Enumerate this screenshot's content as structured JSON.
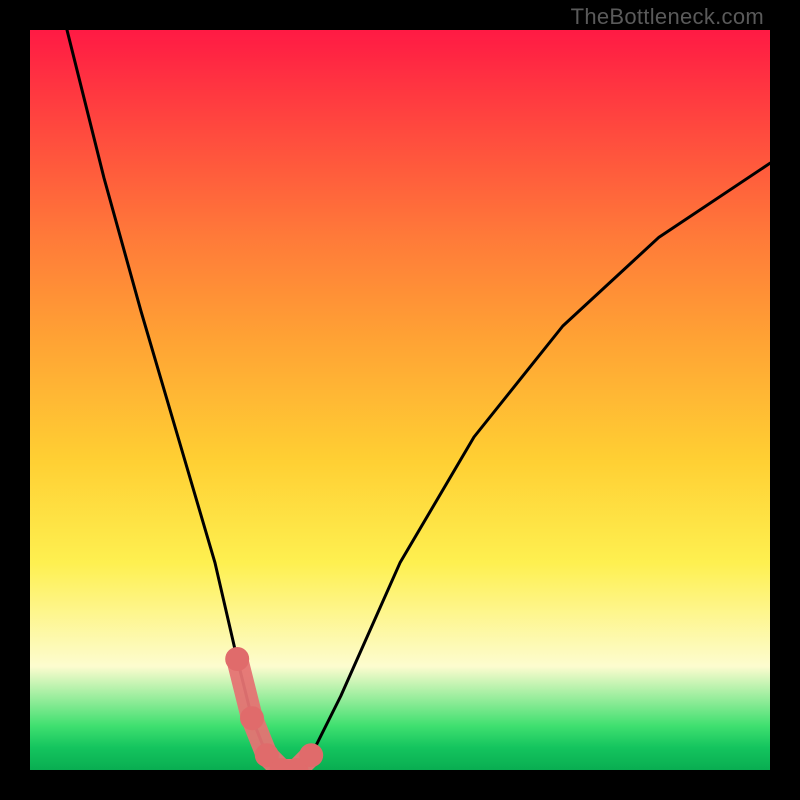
{
  "watermark": "TheBottleneck.com",
  "chart_data": {
    "type": "line",
    "title": "",
    "xlabel": "",
    "ylabel": "",
    "xlim": [
      0,
      100
    ],
    "ylim": [
      0,
      100
    ],
    "series": [
      {
        "name": "bottleneck-curve",
        "x": [
          5,
          10,
          15,
          20,
          25,
          28,
          30,
          32,
          34,
          36,
          38,
          42,
          50,
          60,
          72,
          85,
          100
        ],
        "y": [
          100,
          80,
          62,
          45,
          28,
          15,
          7,
          2,
          0,
          0,
          2,
          10,
          28,
          45,
          60,
          72,
          82
        ]
      }
    ],
    "highlight": {
      "name": "optimal-zone",
      "x": [
        28,
        30,
        32,
        34,
        36,
        38
      ],
      "y": [
        15,
        7,
        2,
        0,
        0,
        2
      ]
    },
    "gradient_stops": [
      {
        "pos": 0.0,
        "color": "#ff1a44"
      },
      {
        "pos": 0.5,
        "color": "#ffcf33"
      },
      {
        "pos": 0.88,
        "color": "#fdfccf"
      },
      {
        "pos": 1.0,
        "color": "#09ad51"
      }
    ]
  }
}
